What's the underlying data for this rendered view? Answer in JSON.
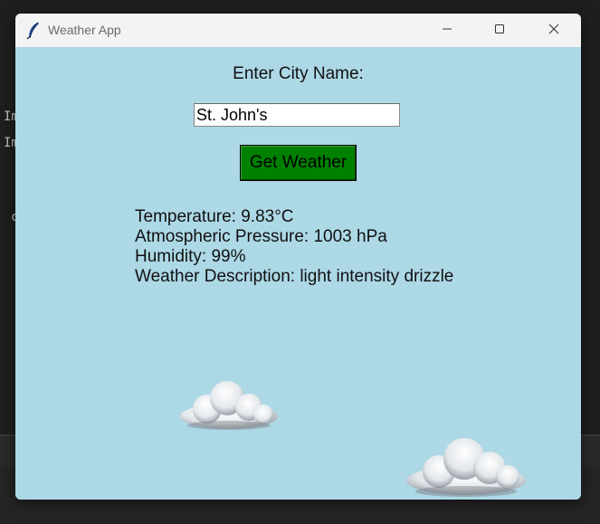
{
  "window": {
    "title": "Weather App"
  },
  "background": {
    "code_lines": [
      "Im",
      "Im",
      "c"
    ]
  },
  "form": {
    "prompt_label": "Enter City Name:",
    "city_value": "St. John's",
    "button_label": "Get Weather"
  },
  "results": {
    "temperature": "Temperature: 9.83°C",
    "pressure": "Atmospheric Pressure: 1003 hPa",
    "humidity": "Humidity: 99%",
    "description": "Weather Description: light intensity drizzle"
  },
  "colors": {
    "client_background": "#add8e6",
    "button_background": "#008000",
    "titlebar": "#f3f3f3"
  },
  "icons": {
    "app_icon": "feather-icon",
    "minimize": "minimize-icon",
    "maximize": "maximize-icon",
    "close": "close-icon",
    "cloud": "cloud-icon"
  }
}
